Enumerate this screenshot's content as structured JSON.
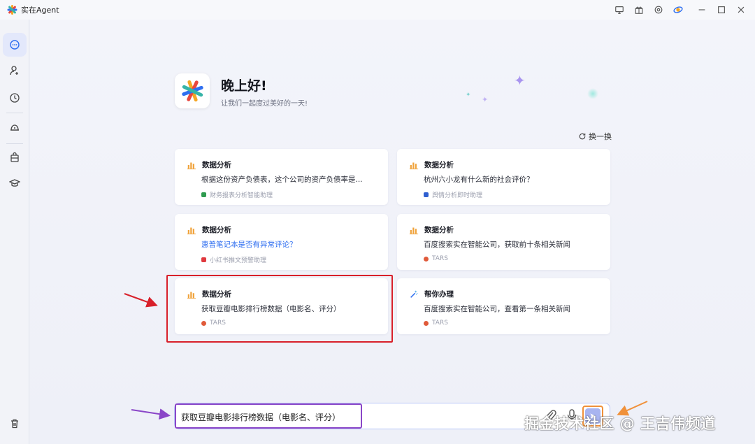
{
  "app": {
    "title": "实在Agent",
    "logo_colors": [
      "#f5a623",
      "#e8473f",
      "#2f6ff0",
      "#36b4a7"
    ]
  },
  "titlebar": {
    "icons": [
      "monitor-icon",
      "gift-icon",
      "target-icon",
      "agent-badge-icon",
      "minimize-icon",
      "maximize-icon",
      "close-icon"
    ]
  },
  "sidebar": {
    "items": [
      "chat-icon",
      "user-add-icon",
      "clock-icon",
      "robot-icon",
      "bag-icon",
      "graduation-cap-icon",
      "trash-icon"
    ],
    "active": "chat-icon"
  },
  "greeting": {
    "title": "晚上好!",
    "subtitle": "让我们一起度过美好的一天!"
  },
  "refresh_label": "换一换",
  "cards": [
    {
      "icon": "bar-chart-icon",
      "title": "数据分析",
      "text": "根据这份资产负债表，这个公司的资产负债率是...",
      "source": "财务报表分析智能助理",
      "source_color": "#2e9b4f",
      "link": false
    },
    {
      "icon": "bar-chart-icon",
      "title": "数据分析",
      "text": "杭州六小龙有什么新的社会评价？",
      "source": "舆情分析即时助理",
      "source_color": "#2f5fd0",
      "link": false
    },
    {
      "icon": "bar-chart-icon",
      "title": "数据分析",
      "text": "惠普笔记本是否有异常评论？",
      "source": "小红书推文预警助理",
      "source_color": "#e0393e",
      "link": true
    },
    {
      "icon": "bar-chart-icon",
      "title": "数据分析",
      "text": "百度搜索实在智能公司，获取前十条相关新闻",
      "source": "TARS",
      "source_color": "#e05a3a",
      "link": false
    },
    {
      "icon": "bar-chart-icon",
      "title": "数据分析",
      "text": "获取豆瓣电影排行榜数据（电影名、评分）",
      "source": "TARS",
      "source_color": "#e05a3a",
      "link": false
    },
    {
      "icon": "magic-wand-icon",
      "title": "帮你办理",
      "text": "百度搜索实在智能公司，查看第一条相关新闻",
      "source": "TARS",
      "source_color": "#e05a3a",
      "link": false
    }
  ],
  "input": {
    "value": "获取豆瓣电影排行榜数据（电影名、评分）",
    "send_label": "➤"
  },
  "watermark": "掘金技术社区 @ 王吉伟频道",
  "colors": {
    "accent": "#2d6df0",
    "highlight_red": "#d8202a",
    "highlight_purple": "#8a46c8",
    "highlight_orange": "#f0913a"
  }
}
